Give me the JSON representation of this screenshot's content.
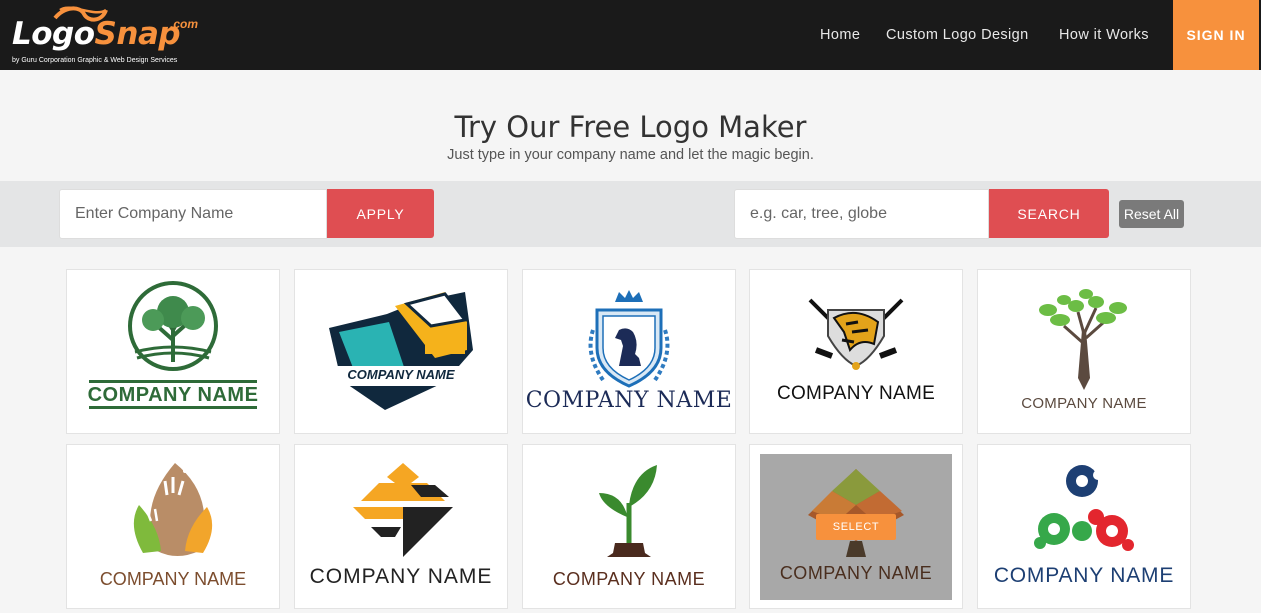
{
  "header": {
    "brand_logo": "Logo",
    "brand_snap": "Snap",
    "brand_dotcom": ".com",
    "brand_tagline": "by Guru Corporation Graphic & Web Design Services",
    "nav": [
      "Home",
      "Custom Logo Design",
      "How it Works"
    ],
    "signin_label": "SIGN IN"
  },
  "hero": {
    "title": "Try Our Free Logo Maker",
    "subtitle": "Just type in your company name and let the magic begin."
  },
  "search": {
    "company_placeholder": "Enter Company Name",
    "apply_label": "APPLY",
    "keyword_placeholder": "e.g. car, tree, globe",
    "search_label": "SEARCH",
    "reset_label": "Reset All"
  },
  "colors": {
    "accent_orange": "#f7913d",
    "button_red": "#df4e52",
    "header_bg": "#1a1a1a"
  },
  "logos": [
    {
      "name": "COMPANY NAME",
      "icon": "tree-circle-icon"
    },
    {
      "name": "COMPANY NAME",
      "icon": "bus-shield-icon"
    },
    {
      "name": "COMPANY NAME",
      "icon": "chess-knight-crest-icon"
    },
    {
      "name": "COMPANY NAME",
      "icon": "eagle-hockey-sticks-icon"
    },
    {
      "name": "COMPANY NAME",
      "icon": "pen-tree-icon"
    },
    {
      "name": "COMPANY NAME",
      "icon": "hands-leaf-icon"
    },
    {
      "name": "COMPANY NAME",
      "icon": "stacked-diamond-icon"
    },
    {
      "name": "COMPANY NAME",
      "icon": "sprout-inkwell-icon"
    },
    {
      "name": "COMPANY NAME",
      "icon": "pattern-diamond-icon",
      "hover_label": "SELECT"
    },
    {
      "name": "COMPANY NAME",
      "icon": "molecule-circles-icon"
    }
  ]
}
